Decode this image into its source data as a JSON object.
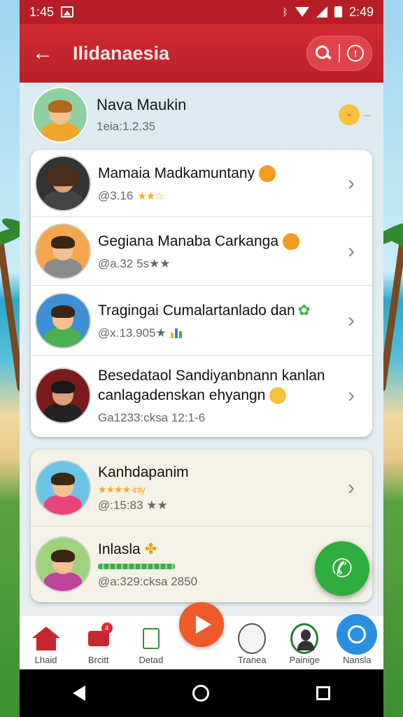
{
  "status_bar": {
    "time": "1:45",
    "clock": "2:49"
  },
  "app_bar": {
    "title": "Ilidanaesia"
  },
  "top_contact": {
    "name": "Nava Maukin",
    "sub": "1eia:1.2.35"
  },
  "card1": {
    "rows": [
      {
        "name": "Mamaia Madkamuntany",
        "meta": "@3.16",
        "stars": "★★☆"
      },
      {
        "name": "Gegiana Manaba Carkanga",
        "meta": "@a.32 5s★★",
        "stars": ""
      },
      {
        "name": "Tragingai Cumalartanlado dan",
        "meta": "@x.13.905★",
        "stars": ""
      },
      {
        "name": "Besedataol Sandiyanbnann kanlan canlagadenskan ehyangn",
        "meta": "Ga1233:cksa 12:1-6",
        "stars": ""
      }
    ]
  },
  "card2": {
    "rows": [
      {
        "name": "Kanhdapanim",
        "tagline": "★★★★·iniy",
        "meta": "@:15:83 ★★"
      },
      {
        "name": "Inlasla",
        "meta": "@a:329:cksa 2850"
      }
    ]
  },
  "bottom_nav": {
    "items": [
      {
        "label": "Lhaid"
      },
      {
        "label": "Brcitt",
        "badge": "4"
      },
      {
        "label": "Detad"
      },
      {
        "label": "Tranea"
      },
      {
        "label": "Painige"
      },
      {
        "label": "Nansla"
      }
    ]
  },
  "colors": {
    "primary": "#c8262d",
    "fab": "#2eae3e",
    "play": "#f0592a",
    "accent_blue": "#2a8fe0"
  }
}
